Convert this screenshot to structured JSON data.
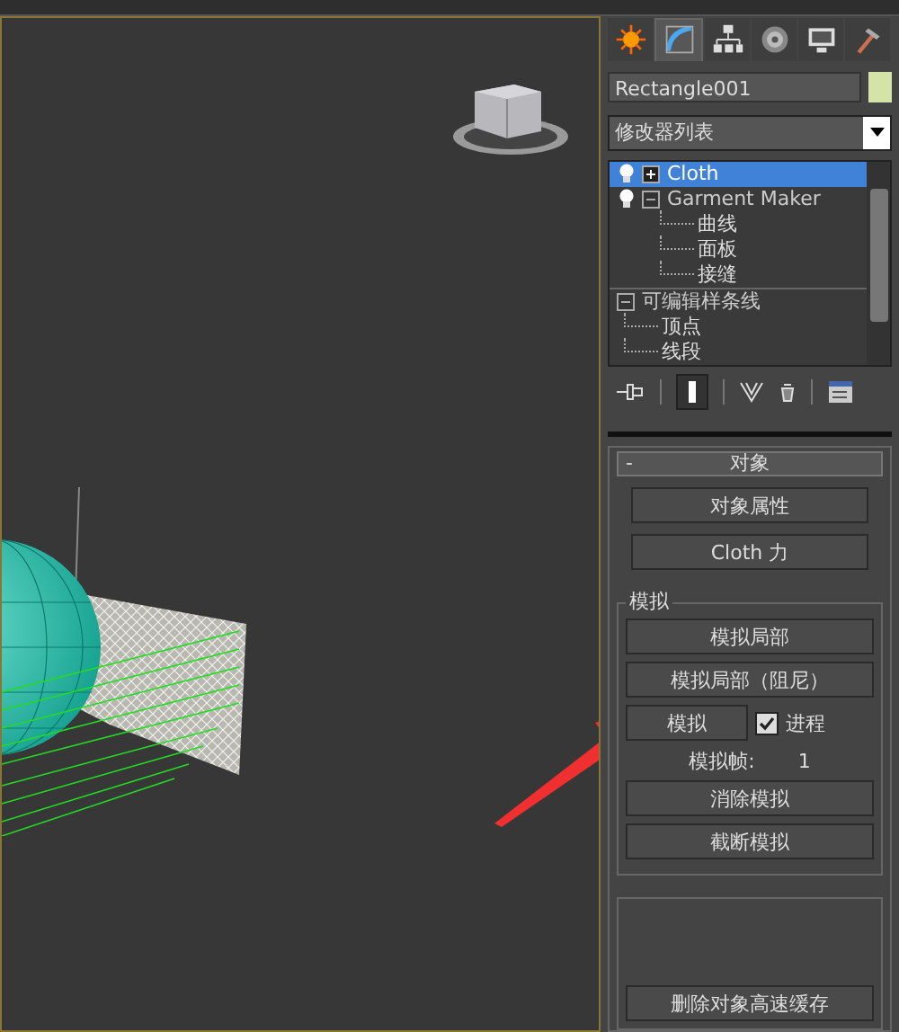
{
  "command_tabs": [
    {
      "selected": false
    },
    {
      "selected": true
    },
    {
      "selected": false
    },
    {
      "selected": false
    },
    {
      "selected": false
    },
    {
      "selected": false
    }
  ],
  "object_name": "Rectangle001",
  "modifier_list": {
    "value": "修改器列表"
  },
  "stack": [
    {
      "kind": "modifier",
      "label": "Cloth",
      "expanded": false,
      "selected": true
    },
    {
      "kind": "modifier",
      "label": "Garment Maker",
      "expanded": true,
      "selected": false,
      "children": [
        {
          "label": "曲线"
        },
        {
          "label": "面板"
        },
        {
          "label": "接缝"
        }
      ]
    },
    {
      "kind": "base",
      "label": "可编辑样条线",
      "expanded": true,
      "selected": false,
      "children": [
        {
          "label": "顶点"
        },
        {
          "label": "线段"
        }
      ]
    }
  ],
  "rollout": {
    "toggle": "-",
    "title": "对象",
    "buttons": [
      "对象属性",
      "Cloth 力"
    ],
    "simulation": {
      "title": "模拟",
      "buttons": [
        "模拟局部",
        "模拟局部（阻尼）"
      ],
      "simulate_button": "模拟",
      "progress": {
        "label": "进程",
        "checked": true
      },
      "frame": {
        "label": "模拟帧:",
        "value": "1"
      },
      "more_buttons": [
        "消除模拟",
        "截断模拟"
      ]
    },
    "cache_buttons": [
      "删除对象高速缓存"
    ]
  }
}
